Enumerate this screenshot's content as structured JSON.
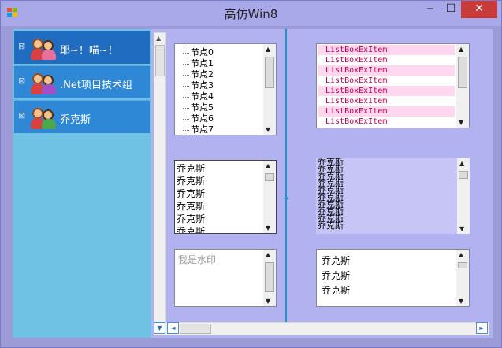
{
  "window": {
    "title": "高仿Win8",
    "minimize_glyph": "‒",
    "maximize_glyph": "☐",
    "close_glyph": "✕"
  },
  "sidebar": {
    "items": [
      {
        "label": "耶~！喵~！",
        "icon": "user-group-icon",
        "remove_glyph": "⊠"
      },
      {
        "label": ".Net项目技术组",
        "icon": "user-group-icon",
        "remove_glyph": "⊠"
      },
      {
        "label": "乔克斯",
        "icon": "user-group-icon",
        "remove_glyph": "⊠"
      }
    ]
  },
  "tree": {
    "nodes": [
      "节点0",
      "节点1",
      "节点2",
      "节点3",
      "节点4",
      "节点5",
      "节点6",
      "节点7"
    ]
  },
  "listbox_ex": {
    "items": [
      "ListBoxExItem",
      "ListBoxExItem",
      "ListBoxExItem",
      "ListBoxExItem",
      "ListBoxExItem",
      "ListBoxExItem",
      "ListBoxExItem",
      "ListBoxExItem"
    ]
  },
  "list_left": {
    "items": [
      "乔克斯",
      "乔克斯",
      "乔克斯",
      "乔克斯",
      "乔克斯",
      "乔克斯"
    ]
  },
  "list_tight": {
    "items": [
      "乔克斯",
      "乔克斯",
      "乔克斯",
      "乔克斯",
      "乔克斯",
      "乔克斯",
      "乔克斯",
      "乔克斯",
      "乔克斯",
      "乔克斯"
    ]
  },
  "watermark_box": {
    "placeholder": "我是水印"
  },
  "list_right": {
    "items": [
      "乔克斯",
      "乔克斯",
      "乔克斯"
    ]
  },
  "scroll_glyphs": {
    "up": "▲",
    "down": "▼",
    "left": "◄",
    "right": "►"
  },
  "colors": {
    "accent": "#2f88d6",
    "close": "#c83b3b",
    "background": "#b3b2f0",
    "listbox_text": "#c0004f",
    "listbox_alt_row": "#ffd7ee"
  }
}
